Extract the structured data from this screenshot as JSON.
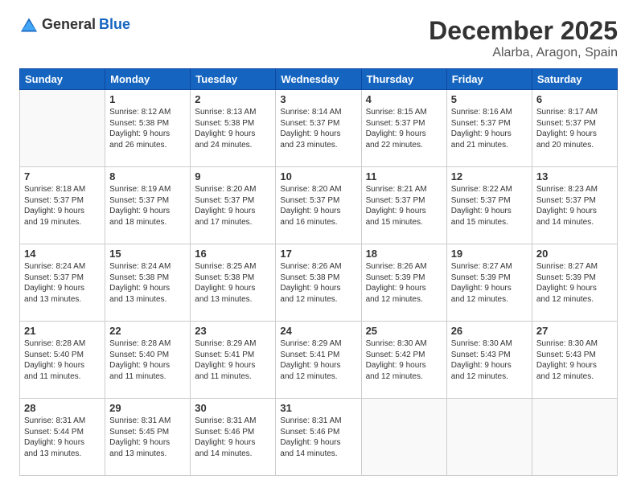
{
  "header": {
    "logo_general": "General",
    "logo_blue": "Blue",
    "month": "December 2025",
    "location": "Alarba, Aragon, Spain"
  },
  "days_of_week": [
    "Sunday",
    "Monday",
    "Tuesday",
    "Wednesday",
    "Thursday",
    "Friday",
    "Saturday"
  ],
  "weeks": [
    [
      {
        "day": "",
        "info": ""
      },
      {
        "day": "1",
        "info": "Sunrise: 8:12 AM\nSunset: 5:38 PM\nDaylight: 9 hours\nand 26 minutes."
      },
      {
        "day": "2",
        "info": "Sunrise: 8:13 AM\nSunset: 5:38 PM\nDaylight: 9 hours\nand 24 minutes."
      },
      {
        "day": "3",
        "info": "Sunrise: 8:14 AM\nSunset: 5:37 PM\nDaylight: 9 hours\nand 23 minutes."
      },
      {
        "day": "4",
        "info": "Sunrise: 8:15 AM\nSunset: 5:37 PM\nDaylight: 9 hours\nand 22 minutes."
      },
      {
        "day": "5",
        "info": "Sunrise: 8:16 AM\nSunset: 5:37 PM\nDaylight: 9 hours\nand 21 minutes."
      },
      {
        "day": "6",
        "info": "Sunrise: 8:17 AM\nSunset: 5:37 PM\nDaylight: 9 hours\nand 20 minutes."
      }
    ],
    [
      {
        "day": "7",
        "info": "Sunrise: 8:18 AM\nSunset: 5:37 PM\nDaylight: 9 hours\nand 19 minutes."
      },
      {
        "day": "8",
        "info": "Sunrise: 8:19 AM\nSunset: 5:37 PM\nDaylight: 9 hours\nand 18 minutes."
      },
      {
        "day": "9",
        "info": "Sunrise: 8:20 AM\nSunset: 5:37 PM\nDaylight: 9 hours\nand 17 minutes."
      },
      {
        "day": "10",
        "info": "Sunrise: 8:20 AM\nSunset: 5:37 PM\nDaylight: 9 hours\nand 16 minutes."
      },
      {
        "day": "11",
        "info": "Sunrise: 8:21 AM\nSunset: 5:37 PM\nDaylight: 9 hours\nand 15 minutes."
      },
      {
        "day": "12",
        "info": "Sunrise: 8:22 AM\nSunset: 5:37 PM\nDaylight: 9 hours\nand 15 minutes."
      },
      {
        "day": "13",
        "info": "Sunrise: 8:23 AM\nSunset: 5:37 PM\nDaylight: 9 hours\nand 14 minutes."
      }
    ],
    [
      {
        "day": "14",
        "info": "Sunrise: 8:24 AM\nSunset: 5:37 PM\nDaylight: 9 hours\nand 13 minutes."
      },
      {
        "day": "15",
        "info": "Sunrise: 8:24 AM\nSunset: 5:38 PM\nDaylight: 9 hours\nand 13 minutes."
      },
      {
        "day": "16",
        "info": "Sunrise: 8:25 AM\nSunset: 5:38 PM\nDaylight: 9 hours\nand 13 minutes."
      },
      {
        "day": "17",
        "info": "Sunrise: 8:26 AM\nSunset: 5:38 PM\nDaylight: 9 hours\nand 12 minutes."
      },
      {
        "day": "18",
        "info": "Sunrise: 8:26 AM\nSunset: 5:39 PM\nDaylight: 9 hours\nand 12 minutes."
      },
      {
        "day": "19",
        "info": "Sunrise: 8:27 AM\nSunset: 5:39 PM\nDaylight: 9 hours\nand 12 minutes."
      },
      {
        "day": "20",
        "info": "Sunrise: 8:27 AM\nSunset: 5:39 PM\nDaylight: 9 hours\nand 12 minutes."
      }
    ],
    [
      {
        "day": "21",
        "info": "Sunrise: 8:28 AM\nSunset: 5:40 PM\nDaylight: 9 hours\nand 11 minutes."
      },
      {
        "day": "22",
        "info": "Sunrise: 8:28 AM\nSunset: 5:40 PM\nDaylight: 9 hours\nand 11 minutes."
      },
      {
        "day": "23",
        "info": "Sunrise: 8:29 AM\nSunset: 5:41 PM\nDaylight: 9 hours\nand 11 minutes."
      },
      {
        "day": "24",
        "info": "Sunrise: 8:29 AM\nSunset: 5:41 PM\nDaylight: 9 hours\nand 12 minutes."
      },
      {
        "day": "25",
        "info": "Sunrise: 8:30 AM\nSunset: 5:42 PM\nDaylight: 9 hours\nand 12 minutes."
      },
      {
        "day": "26",
        "info": "Sunrise: 8:30 AM\nSunset: 5:43 PM\nDaylight: 9 hours\nand 12 minutes."
      },
      {
        "day": "27",
        "info": "Sunrise: 8:30 AM\nSunset: 5:43 PM\nDaylight: 9 hours\nand 12 minutes."
      }
    ],
    [
      {
        "day": "28",
        "info": "Sunrise: 8:31 AM\nSunset: 5:44 PM\nDaylight: 9 hours\nand 13 minutes."
      },
      {
        "day": "29",
        "info": "Sunrise: 8:31 AM\nSunset: 5:45 PM\nDaylight: 9 hours\nand 13 minutes."
      },
      {
        "day": "30",
        "info": "Sunrise: 8:31 AM\nSunset: 5:46 PM\nDaylight: 9 hours\nand 14 minutes."
      },
      {
        "day": "31",
        "info": "Sunrise: 8:31 AM\nSunset: 5:46 PM\nDaylight: 9 hours\nand 14 minutes."
      },
      {
        "day": "",
        "info": ""
      },
      {
        "day": "",
        "info": ""
      },
      {
        "day": "",
        "info": ""
      }
    ]
  ]
}
